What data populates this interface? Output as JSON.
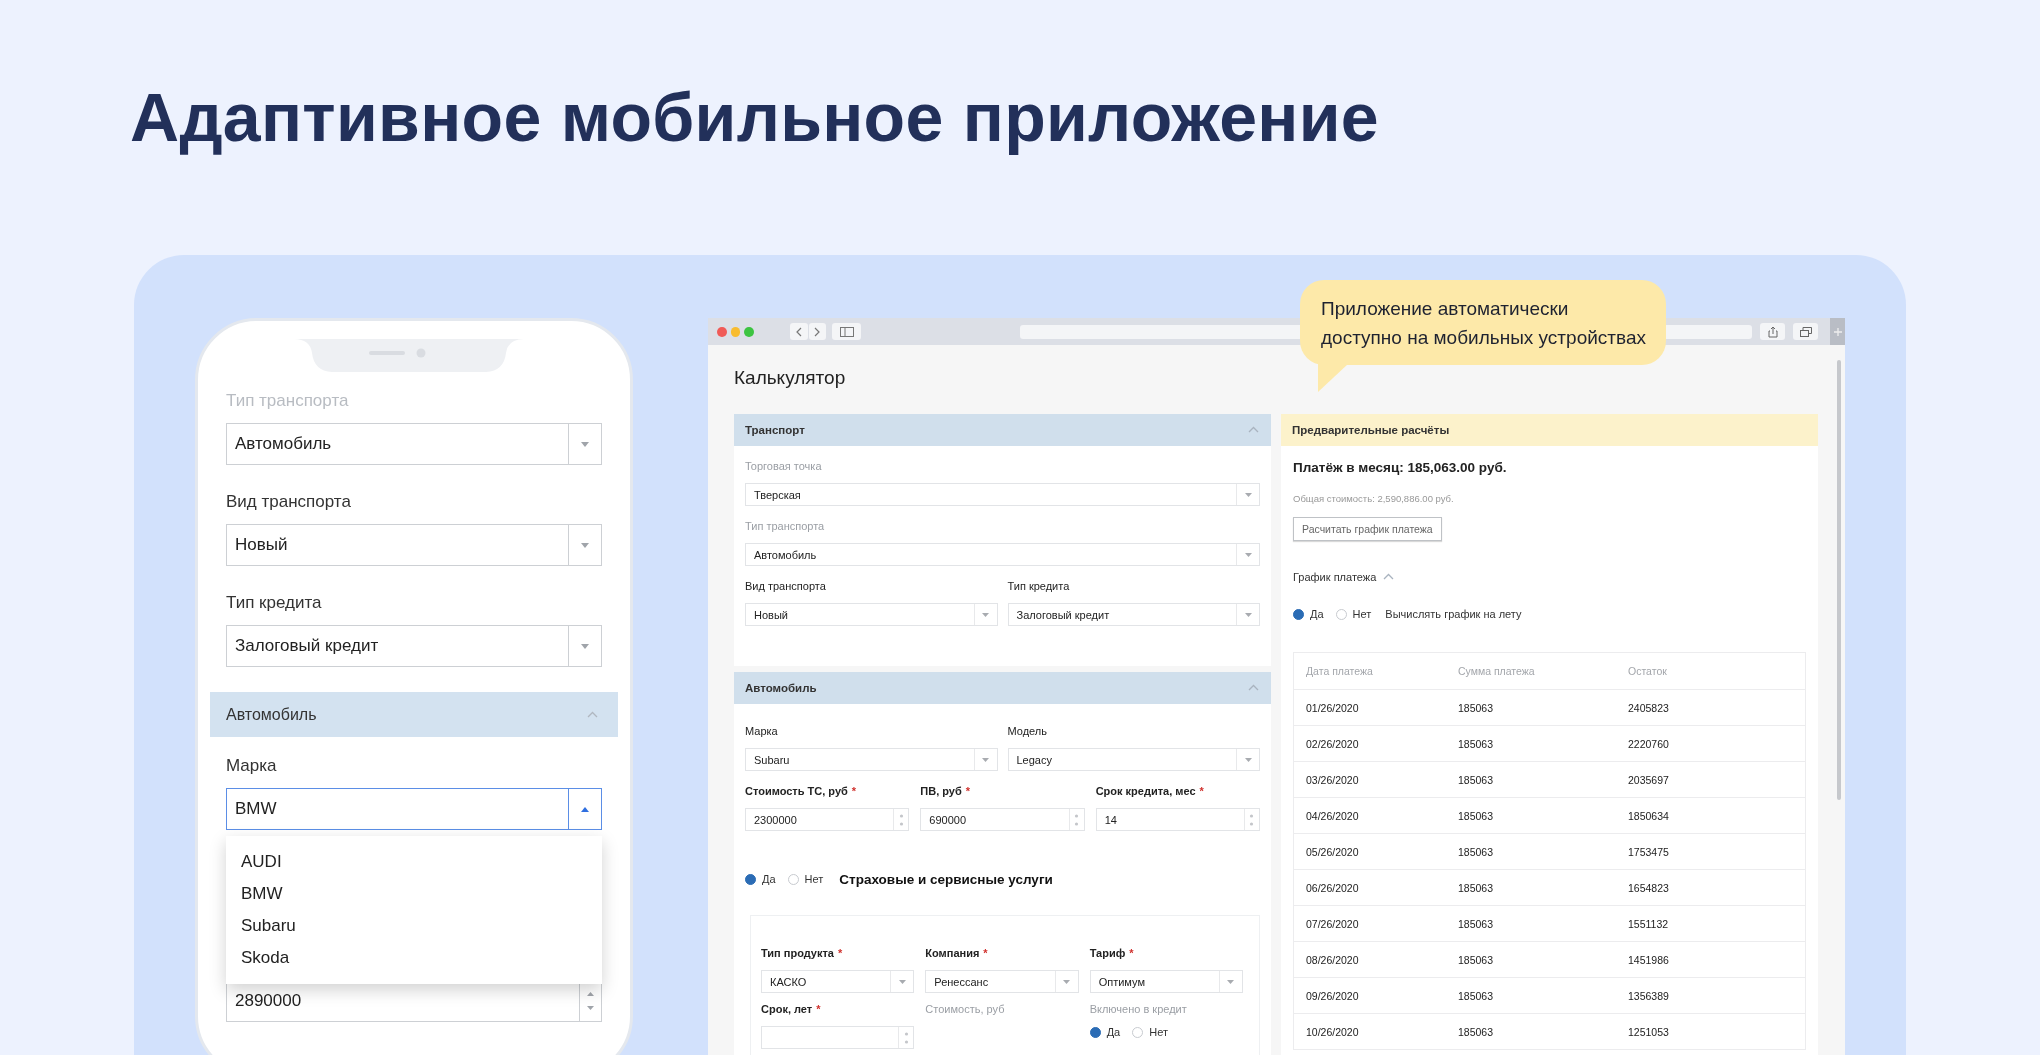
{
  "heading": "Адаптивное мобильное приложение",
  "phone": {
    "fields": [
      {
        "label": "Тип транспорта",
        "value": "Автомобиль",
        "faded": true
      },
      {
        "label": "Вид транспорта",
        "value": "Новый",
        "faded": false
      },
      {
        "label": "Тип кредита",
        "value": "Залоговый кредит",
        "faded": false
      }
    ],
    "section": {
      "title": "Автомобиль",
      "expanded": true
    },
    "brand": {
      "label": "Марка",
      "value": "BMW",
      "open": true,
      "options": [
        "AUDI",
        "BMW",
        "Subaru",
        "Skoda"
      ]
    },
    "price_field": {
      "value": "2890000"
    }
  },
  "callout": "Приложение автоматически\nдоступно на мобильных устройствах",
  "browser": {
    "page_title": "Калькулятор",
    "sections": [
      {
        "title": "Транспорт",
        "expanded": true,
        "rows": [
          [
            {
              "label": "Торговая точка",
              "muted": true,
              "kind": "select",
              "value": "Тверская"
            }
          ],
          [
            {
              "label": "Тип транспорта",
              "muted": true,
              "kind": "select",
              "value": "Автомобиль"
            }
          ],
          [
            {
              "label": "Вид транспорта",
              "muted": false,
              "kind": "select",
              "value": "Новый"
            },
            {
              "label": "Тип кредита",
              "muted": false,
              "kind": "select",
              "value": "Залоговый кредит"
            }
          ]
        ]
      },
      {
        "title": "Автомобиль",
        "expanded": true,
        "rows": [
          [
            {
              "label": "Марка",
              "muted": false,
              "kind": "select",
              "value": "Subaru"
            },
            {
              "label": "Модель",
              "muted": false,
              "kind": "select",
              "value": "Legacy"
            }
          ],
          [
            {
              "label": "Стоимость ТС, руб",
              "required_mark": "*",
              "muted": false,
              "kind": "number",
              "value": "2300000"
            },
            {
              "label": "ПВ, руб",
              "required_mark": "*",
              "muted": false,
              "kind": "number",
              "value": "690000"
            },
            {
              "label": "Срок кредита, мес",
              "required_mark": "*",
              "muted": false,
              "kind": "number",
              "value": "14"
            }
          ]
        ]
      }
    ],
    "insurance": {
      "options": [
        {
          "label": "Да",
          "selected": true
        },
        {
          "label": "Нет",
          "selected": false
        }
      ],
      "title": "Страховые и сервисные услуги",
      "rows": [
        [
          {
            "label": "Тип продукта",
            "required_mark": "*",
            "muted": false,
            "kind": "select",
            "value": "КАСКО"
          },
          {
            "label": "Компания",
            "required_mark": "*",
            "muted": false,
            "kind": "select",
            "value": "Ренессанс"
          },
          {
            "label": "Тариф",
            "required_mark": "*",
            "muted": false,
            "kind": "select",
            "value": "Оптимум"
          }
        ],
        [
          {
            "label": "Срок, лет",
            "required_mark": "*",
            "muted": false,
            "kind": "number"
          },
          {
            "label": "Стоимость, руб",
            "muted": true,
            "kind": "none"
          },
          {
            "label": "Включено в кредит",
            "muted": true,
            "kind": "radio",
            "options": [
              {
                "label": "Да",
                "selected": true
              },
              {
                "label": "Нет",
                "selected": false
              }
            ]
          }
        ]
      ]
    },
    "results": {
      "title": "Предварительные расчёты",
      "monthly": "Платёж в месяц: 185,063.00 руб.",
      "total": "Общая стоимость: 2,590,886.00 руб.",
      "button": "Расчитать график платежа",
      "schedule": {
        "title": "График платежа",
        "expanded": true
      },
      "live": {
        "options": [
          {
            "label": "Да",
            "selected": true
          },
          {
            "label": "Нет",
            "selected": false
          }
        ],
        "label": "Вычислять график на лету"
      },
      "table": {
        "columns": [
          "Дата платежа",
          "Сумма платежа",
          "Остаток"
        ],
        "rows": [
          [
            "01/26/2020",
            "185063",
            "2405823"
          ],
          [
            "02/26/2020",
            "185063",
            "2220760"
          ],
          [
            "03/26/2020",
            "185063",
            "2035697"
          ],
          [
            "04/26/2020",
            "185063",
            "1850634"
          ],
          [
            "05/26/2020",
            "185063",
            "1753475"
          ],
          [
            "06/26/2020",
            "185063",
            "1654823"
          ],
          [
            "07/26/2020",
            "185063",
            "1551132"
          ],
          [
            "08/26/2020",
            "185063",
            "1451986"
          ],
          [
            "09/26/2020",
            "185063",
            "1356389"
          ],
          [
            "10/26/2020",
            "185063",
            "1251053"
          ]
        ]
      }
    }
  }
}
